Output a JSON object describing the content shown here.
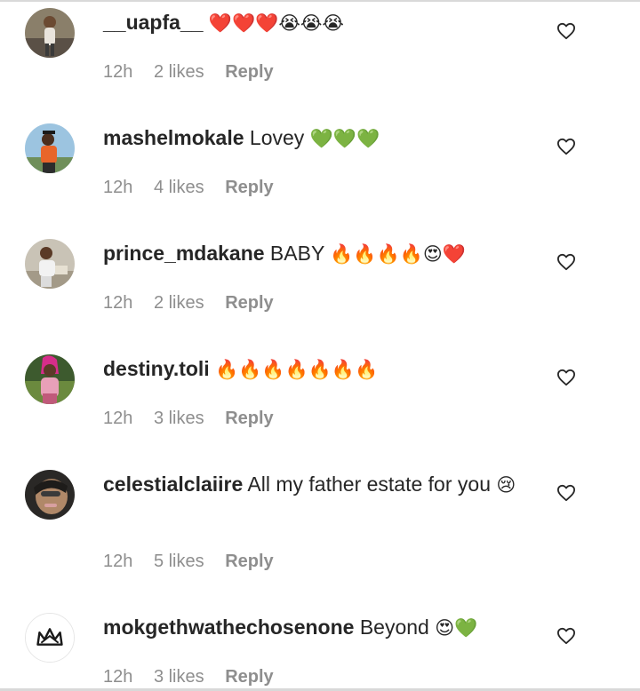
{
  "comments": [
    {
      "username": "__uapfa__",
      "text": "",
      "emoji": "❤️❤️❤️😭😭😭",
      "time": "12h",
      "likes": "2 likes",
      "reply": "Reply"
    },
    {
      "username": "mashelmokale",
      "text": "Lovey",
      "emoji": "💚💚💚",
      "time": "12h",
      "likes": "4 likes",
      "reply": "Reply"
    },
    {
      "username": "prince_mdakane",
      "text": "BABY",
      "emoji": "🔥🔥🔥🔥😍❤️",
      "time": "12h",
      "likes": "2 likes",
      "reply": "Reply"
    },
    {
      "username": "destiny.toli",
      "text": "",
      "emoji": "🔥🔥🔥🔥🔥🔥🔥",
      "time": "12h",
      "likes": "3 likes",
      "reply": "Reply"
    },
    {
      "username": "celestialclaiire",
      "text": "All my father estate for you",
      "emoji": "😢",
      "time": "12h",
      "likes": "5 likes",
      "reply": "Reply"
    },
    {
      "username": "mokgethwathechosenone",
      "text": "Beyond",
      "emoji": "😍💚",
      "time": "12h",
      "likes": "3 likes",
      "reply": "Reply"
    }
  ]
}
